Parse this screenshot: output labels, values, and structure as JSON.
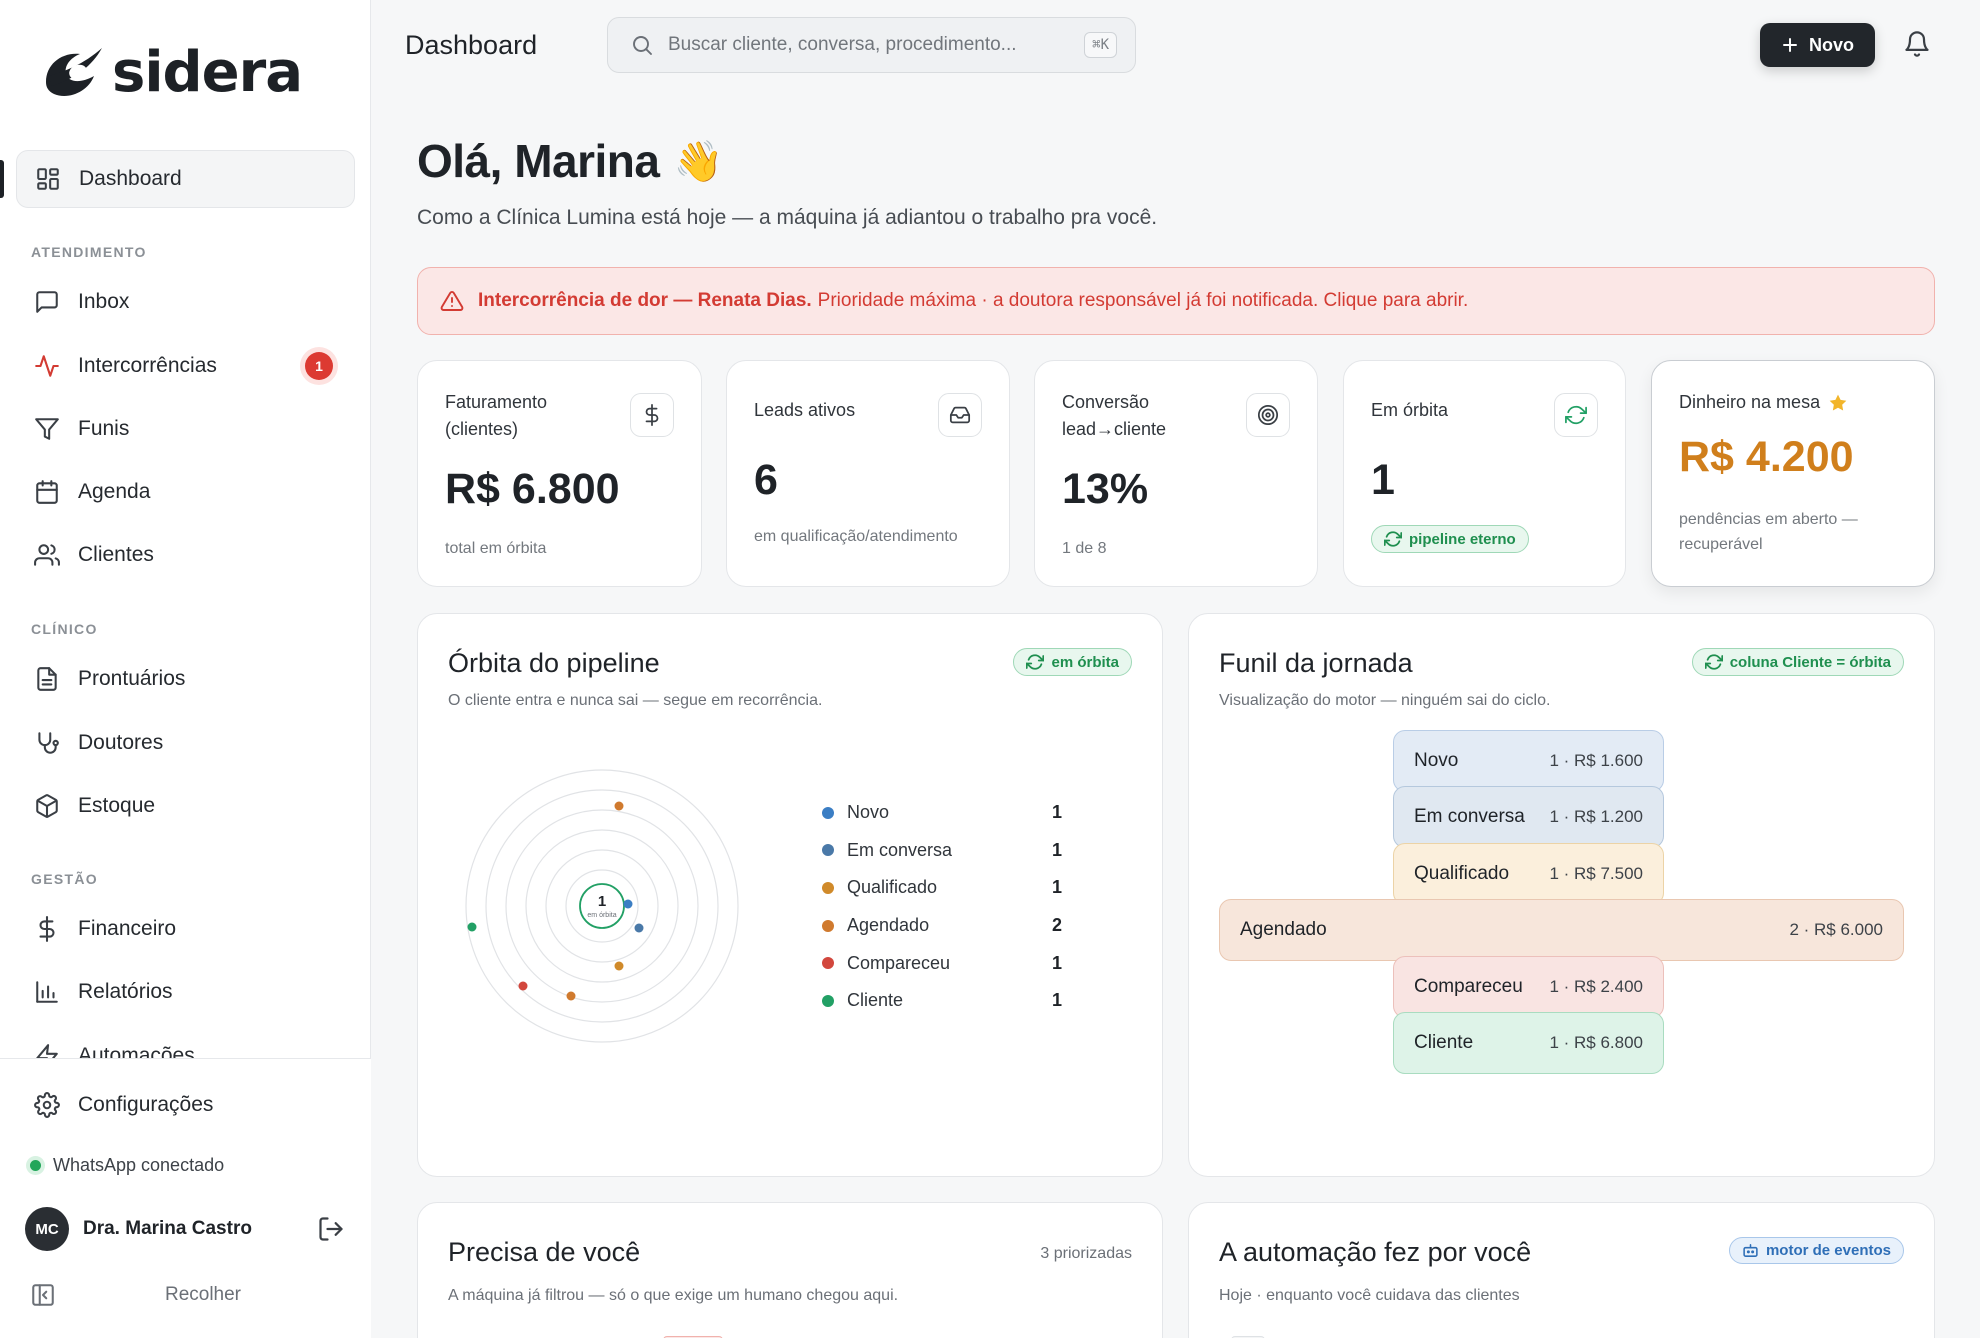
{
  "brand": {
    "name": "sidera"
  },
  "nav": {
    "dashboard": "Dashboard",
    "sections": {
      "atendimento": "ATENDIMENTO",
      "clinico": "CLÍNICO",
      "gestao": "GESTÃO"
    },
    "inbox": "Inbox",
    "intercorrencias": "Intercorrências",
    "intercorrencias_badge": "1",
    "funis": "Funis",
    "agenda": "Agenda",
    "clientes": "Clientes",
    "prontuarios": "Prontuários",
    "doutores": "Doutores",
    "estoque": "Estoque",
    "financeiro": "Financeiro",
    "relatorios": "Relatórios",
    "automacoes": "Automações",
    "configuracoes": "Configurações"
  },
  "status": {
    "whatsapp": "WhatsApp conectado"
  },
  "user": {
    "initials": "MC",
    "name": "Dra. Marina Castro"
  },
  "sidebar_footer": {
    "collapse": "Recolher"
  },
  "header": {
    "title": "Dashboard",
    "search_placeholder": "Buscar cliente, conversa, procedimento...",
    "search_shortcut": "⌘K",
    "new_button": "Novo"
  },
  "greeting": {
    "title": "Olá, Marina",
    "emoji": "👋",
    "subtitle": "Como a Clínica Lumina está hoje — a máquina já adiantou o trabalho pra você."
  },
  "alert": {
    "bold": "Intercorrência de dor — Renata Dias.",
    "text": "Prioridade máxima · a doutora responsável já foi notificada. Clique para abrir."
  },
  "stats": {
    "faturamento": {
      "label": "Faturamento (clientes)",
      "value": "R$ 6.800",
      "sub": "total em órbita"
    },
    "leads": {
      "label": "Leads ativos",
      "value": "6",
      "sub": "em qualificação/atendimento"
    },
    "conversao": {
      "label": "Conversão lead→cliente",
      "value": "13%",
      "sub": "1 de 8"
    },
    "orbita": {
      "label": "Em órbita",
      "value": "1",
      "pill": "pipeline eterno"
    },
    "mesa": {
      "label": "Dinheiro na mesa",
      "value": "R$ 4.200",
      "sub": "pendências em aberto — recuperável"
    }
  },
  "orbit_panel": {
    "title": "Órbita do pipeline",
    "subtitle": "O cliente entra e nunca sai — segue em recorrência.",
    "pill": "em órbita",
    "center_value": "1",
    "center_label": "em órbita",
    "legend": [
      {
        "label": "Novo",
        "count": "1",
        "color": "#3b7ec4"
      },
      {
        "label": "Em conversa",
        "count": "1",
        "color": "#4a79a8"
      },
      {
        "label": "Qualificado",
        "count": "1",
        "color": "#d08a2a"
      },
      {
        "label": "Agendado",
        "count": "2",
        "color": "#d07a2e"
      },
      {
        "label": "Compareceu",
        "count": "1",
        "color": "#d2473d"
      },
      {
        "label": "Cliente",
        "count": "1",
        "color": "#22a065"
      }
    ]
  },
  "funnel_panel": {
    "title": "Funil da jornada",
    "subtitle": "Visualização do motor — ninguém sai do ciclo.",
    "pill": "coluna Cliente = órbita",
    "stages": [
      {
        "label": "Novo",
        "value": "1 · R$ 1.600",
        "bg": "#e3ebf5",
        "border": "#b9cde6"
      },
      {
        "label": "Em conversa",
        "value": "1 · R$ 1.200",
        "bg": "#e0e8f1",
        "border": "#b5c8dd"
      },
      {
        "label": "Qualificado",
        "value": "1 · R$ 7.500",
        "bg": "#fbefdc",
        "border": "#ecd3a6"
      },
      {
        "label": "Agendado",
        "value": "2 · R$ 6.000",
        "bg": "#f7e6db",
        "border": "#e9c7b1"
      },
      {
        "label": "Compareceu",
        "value": "1 · R$ 2.400",
        "bg": "#f9e4e2",
        "border": "#ecc0bb"
      },
      {
        "label": "Cliente",
        "value": "1 · R$ 6.800",
        "bg": "#def3e8",
        "border": "#a9dcc0"
      }
    ]
  },
  "needs_panel": {
    "title": "Precisa de você",
    "subtitle": "A máquina já filtrou — só o que exige um humano chegou aqui.",
    "count": "3 priorizadas"
  },
  "automation_panel": {
    "title": "A automação fez por você",
    "subtitle": "Hoje · enquanto você cuidava das clientes",
    "pill": "motor de eventos"
  }
}
